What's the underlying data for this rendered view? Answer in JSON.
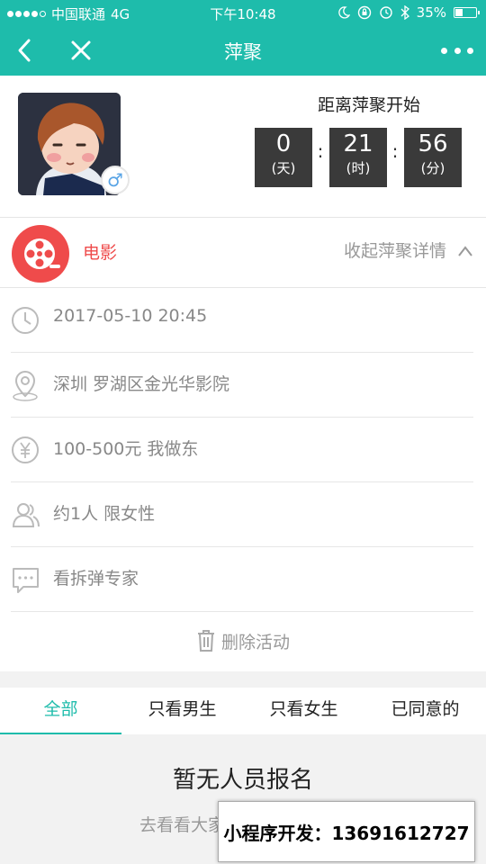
{
  "status_bar": {
    "carrier": "中国联通",
    "network": "4G",
    "time": "下午10:48",
    "battery_pct": "35%"
  },
  "nav": {
    "title": "萍聚"
  },
  "profile": {
    "gender_symbol": "♂"
  },
  "countdown": {
    "title": "距离萍聚开始",
    "days": "0",
    "days_unit": "(天)",
    "hours": "21",
    "hours_unit": "(时)",
    "minutes": "56",
    "minutes_unit": "(分)",
    "sep": ":"
  },
  "category": {
    "label": "电影",
    "collapse_label": "收起萍聚详情"
  },
  "details": {
    "time": "2017-05-10 20:45",
    "location": "深圳 罗湖区金光华影院",
    "cost": "100-500元 我做东",
    "people": "约1人 限女性",
    "note": "看拆弹专家"
  },
  "delete_label": "删除活动",
  "tabs": [
    "全部",
    "只看男生",
    "只看女生",
    "已同意的"
  ],
  "empty": {
    "title": "暂无人员报名",
    "subtitle": "去看看大家"
  },
  "promo": {
    "text": "小程序开发：13691612727"
  },
  "colors": {
    "accent": "#1ebcab",
    "category": "#ef4b4b"
  }
}
